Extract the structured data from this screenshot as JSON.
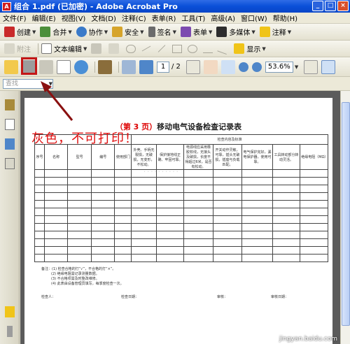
{
  "window": {
    "title": "组合 1.pdf (已加密) - Adobe Acrobat Pro",
    "icon_label": "A",
    "buttons": [
      "_",
      "□",
      "×"
    ]
  },
  "menu": [
    "文件(F)",
    "编辑(E)",
    "视图(V)",
    "文档(D)",
    "注释(C)",
    "表单(R)",
    "工具(T)",
    "高级(A)",
    "窗口(W)",
    "帮助(H)"
  ],
  "toolbar1": {
    "create": "创建",
    "combine": "合并",
    "collaborate": "协作",
    "secure": "安全",
    "sign": "签名",
    "forms": "表单",
    "multimedia": "多媒体",
    "comment": "注释"
  },
  "toolbar2": {
    "attach": "附注",
    "text_edit": "文本编辑",
    "show": "显示"
  },
  "toolbar3": {
    "page_current": "1",
    "page_total": "/ 2",
    "zoom": "53.6%"
  },
  "find": {
    "placeholder": "查找"
  },
  "annotation": {
    "text": "灰色，不可打印！"
  },
  "document": {
    "title_page": "（第 3 页）",
    "title_text": "移动电气设备检查记录表",
    "faint_overlay": "..........",
    "group_header": "检查内容及标准",
    "columns": [
      "序号",
      "名称",
      "型号",
      "编号",
      "使用部门",
      "外壳、手柄无裂损，无破损，无变形，不松动。",
      "保护接地线正确、牢固可靠。",
      "电源线应采用橡胶软线，无接头及破损，长度不得超过6米，是否有松动。",
      "开关动作灵敏，可靠，插头无破损，插座与负载匹配。",
      "电气保护完好，漏电保护器，使用可靠。",
      "工具转动部分转动灵活。",
      "绝缘电阻（MΩ）"
    ],
    "row_count": 12,
    "notes": [
      "备注：(1) 检查合格的打“√”，不合格的打“×”。",
      "(2) 绝缘电阻需记录测量数据。",
      "(3) 不合格项需及时整改维修。",
      "(4) 此表由设备管理员填写，每季度检查一次。"
    ],
    "signatures": [
      "检查人：",
      "检查日期：",
      "审核：",
      "审核日期："
    ]
  },
  "watermark": "jingyan.baidu.com",
  "colors": {
    "title_blue": "#0a4fd8",
    "annotation_red": "#c41717",
    "doc_bg": "#5b5b5b"
  }
}
